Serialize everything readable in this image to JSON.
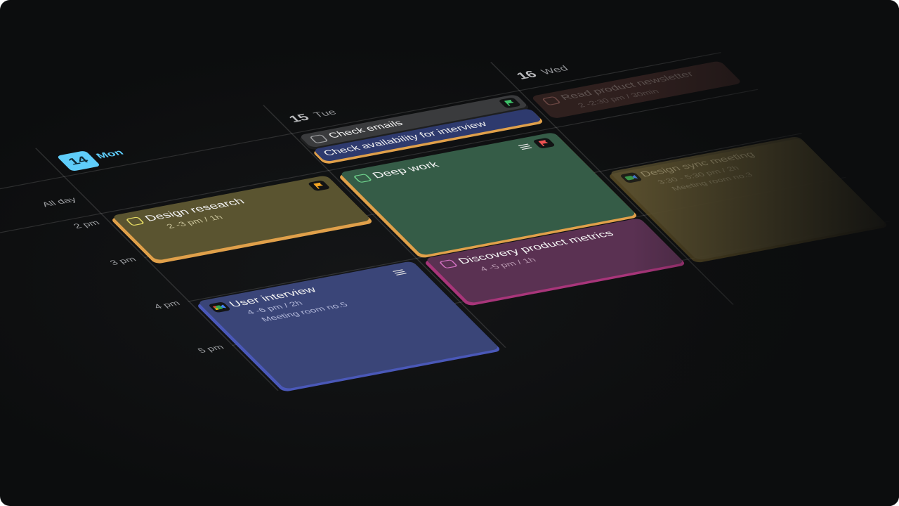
{
  "days": [
    {
      "num": "14",
      "name": "Mon",
      "today": true
    },
    {
      "num": "15",
      "name": "Tue",
      "today": false
    },
    {
      "num": "16",
      "name": "Wed",
      "today": false
    }
  ],
  "row_labels": {
    "all_day": "All day",
    "h2": "2 pm",
    "h3": "3 pm",
    "h4": "4 pm",
    "h5": "5 pm"
  },
  "events": {
    "check_emails": {
      "title": "Check emails",
      "flag": "green-flag-icon"
    },
    "check_availability": {
      "title": "Check availability for interview"
    },
    "read_newsletter": {
      "title": "Read product newsletter",
      "time": "2 -2:30 pm / 30min"
    },
    "deep_work": {
      "title": "Deep work",
      "flag": "red-flag-icon"
    },
    "design_research": {
      "title": "Design research",
      "time": "2 -3 pm / 1h",
      "flag": "orange-flag-icon"
    },
    "design_sync": {
      "title": "Design sync meeting",
      "time": "3:30 - 5:30 pm / 2h",
      "location": "Meeting room no.3"
    },
    "discovery": {
      "title": "Discovery product metrics",
      "time": "4 -5 pm / 1h"
    },
    "user_interview": {
      "title": "User interview",
      "time": "4 -6 pm / 2h",
      "location": "Meeting room no.5"
    }
  },
  "colors": {
    "background": "#0c0d0e",
    "today_accent": "#5fcdfa",
    "edge_accent": "#e0a04a",
    "design_research": "#5a5430",
    "deep_work": "#355c47",
    "user_interview": "#3a4578",
    "discovery": "#5a3152",
    "design_sync": "#5a5030",
    "check_emails": "#3a3b3d",
    "check_availability": "#2e3a6e",
    "read_newsletter": "#3b2624"
  }
}
